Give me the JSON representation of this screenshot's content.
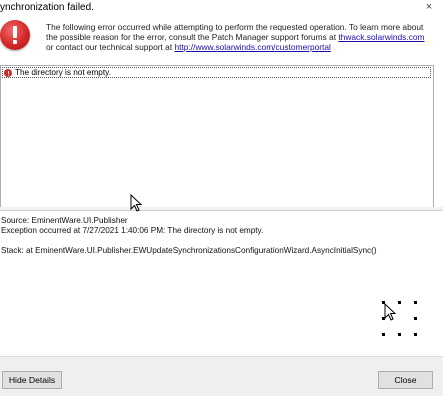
{
  "window": {
    "title": "ynchronization failed.",
    "close_glyph": "×"
  },
  "header": {
    "icon": "error-icon",
    "message_line1": "The following error occurred while attempting to perform the requested operation. To learn more about",
    "message_line2_prefix": "the possible reason for the error, consult the Patch Manager support forums at ",
    "forum_link": "thwack.solarwinds.com",
    "message_line3_prefix": "or contact our technical support at ",
    "support_link": "http://www.solarwinds.com/customerportal"
  },
  "errors": {
    "items": [
      {
        "icon": "error-icon",
        "text": "The directory is not empty."
      }
    ]
  },
  "details": {
    "source": "Source: EminentWare.UI.Publisher",
    "exception": "Exception occurred at 7/27/2021 1:40:06 PM: The directory is not empty.",
    "stack": "Stack:     at EminentWare.UI.Publisher.EWUpdateSynchronizationsConfigurationWizard.AsyncInitialSync()"
  },
  "footer": {
    "hide_details_label": "Hide Details",
    "close_label": "Close"
  }
}
